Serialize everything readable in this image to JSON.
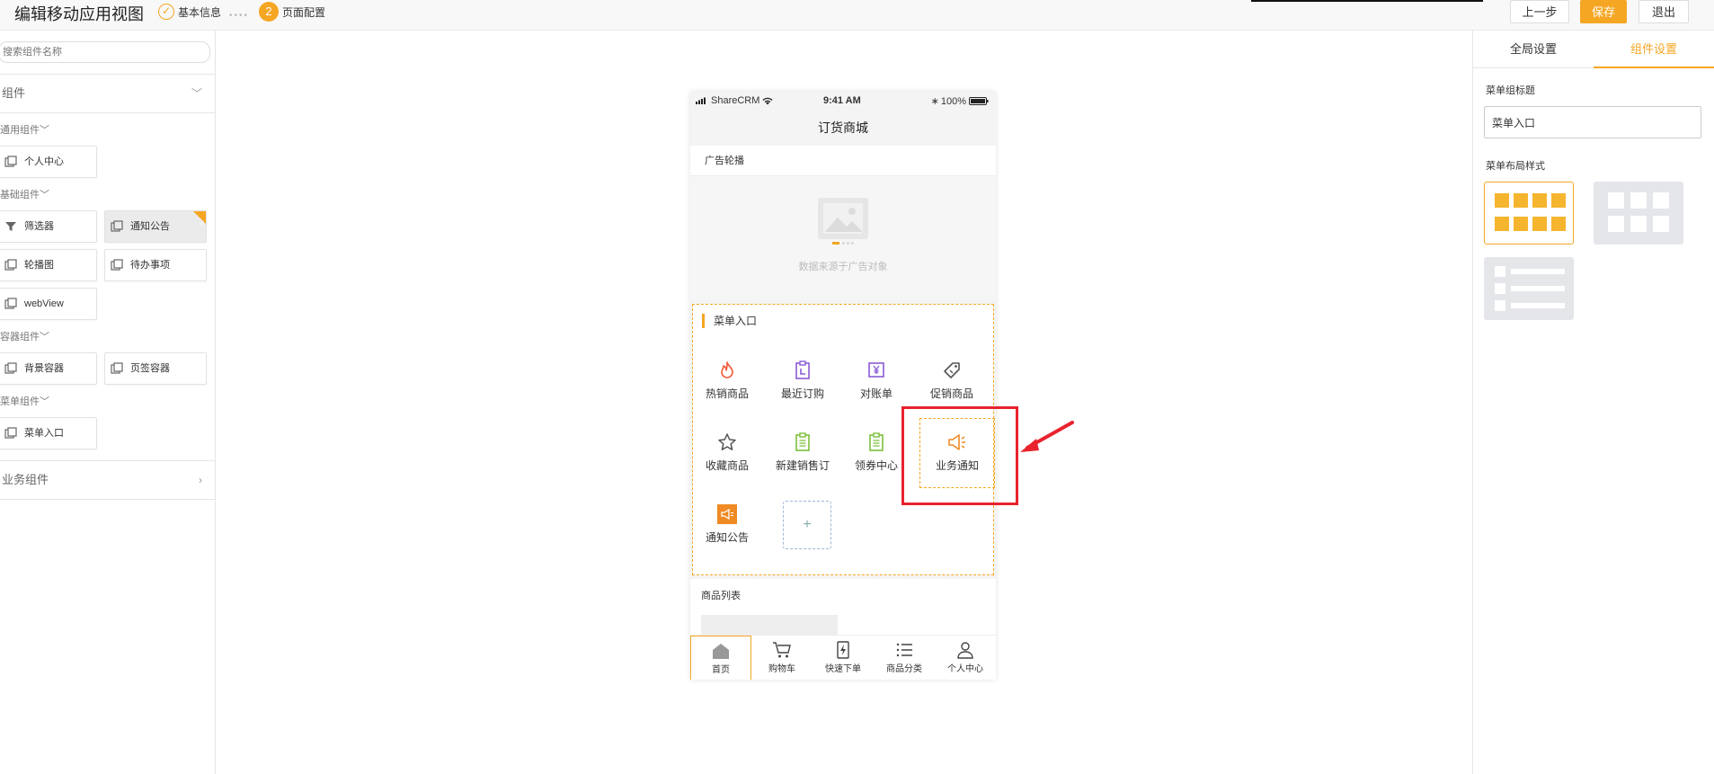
{
  "header": {
    "title": "编辑移动应用视图",
    "step1_label": "基本信息",
    "step2_number": "2",
    "step2_label": "页面配置",
    "prev_label": "上一步",
    "save_label": "保存",
    "exit_label": "退出"
  },
  "sidebar": {
    "search_placeholder": "搜索组件名称",
    "section_components": "组件",
    "groups": {
      "general": "通用组件",
      "basic": "基础组件",
      "container": "容器组件",
      "menu": "菜单组件"
    },
    "items": {
      "personal_center": "个人中心",
      "filter": "筛选器",
      "notice": "通知公告",
      "carousel": "轮播图",
      "todo": "待办事项",
      "webview": "webView",
      "bg_container": "背景容器",
      "tab_container": "页签容器",
      "menu_entry": "菜单入口"
    },
    "section_business": "业务组件"
  },
  "phone": {
    "carrier": "ShareCRM",
    "time": "9:41 AM",
    "battery": "100%",
    "page_title": "订货商城",
    "ad_title": "广告轮播",
    "ad_caption": "数据来源于广告对象",
    "menu_title": "菜单入口",
    "menu_items": [
      {
        "label": "热销商品",
        "icon": "fire-icon",
        "color": "#f05a3a"
      },
      {
        "label": "最近订购",
        "icon": "clipboard-l-icon",
        "color": "#8a5cd6"
      },
      {
        "label": "对账单",
        "icon": "yen-doc-icon",
        "color": "#8a5cd6"
      },
      {
        "label": "促销商品",
        "icon": "tag-icon",
        "color": "#555555"
      },
      {
        "label": "收藏商品",
        "icon": "star-icon",
        "color": "#555555"
      },
      {
        "label": "新建销售订",
        "icon": "clipboard-green-icon",
        "color": "#7cbf3b"
      },
      {
        "label": "领券中心",
        "icon": "clipboard-green-icon",
        "color": "#7cbf3b"
      },
      {
        "label": "业务通知",
        "icon": "megaphone-icon",
        "color": "#f08a24"
      },
      {
        "label": "通知公告",
        "icon": "megaphone-filled-icon",
        "color": "#f08a24"
      }
    ],
    "goods_title": "商品列表",
    "tabs": [
      "首页",
      "购物车",
      "快速下单",
      "商品分类",
      "个人中心"
    ]
  },
  "right_panel": {
    "tab_global": "全局设置",
    "tab_component": "组件设置",
    "menu_title_label": "菜单组标题",
    "menu_title_value": "菜单入口",
    "layout_label": "菜单布局样式"
  },
  "colors": {
    "accent": "#f5a623",
    "annotation_red": "#e8232d"
  }
}
